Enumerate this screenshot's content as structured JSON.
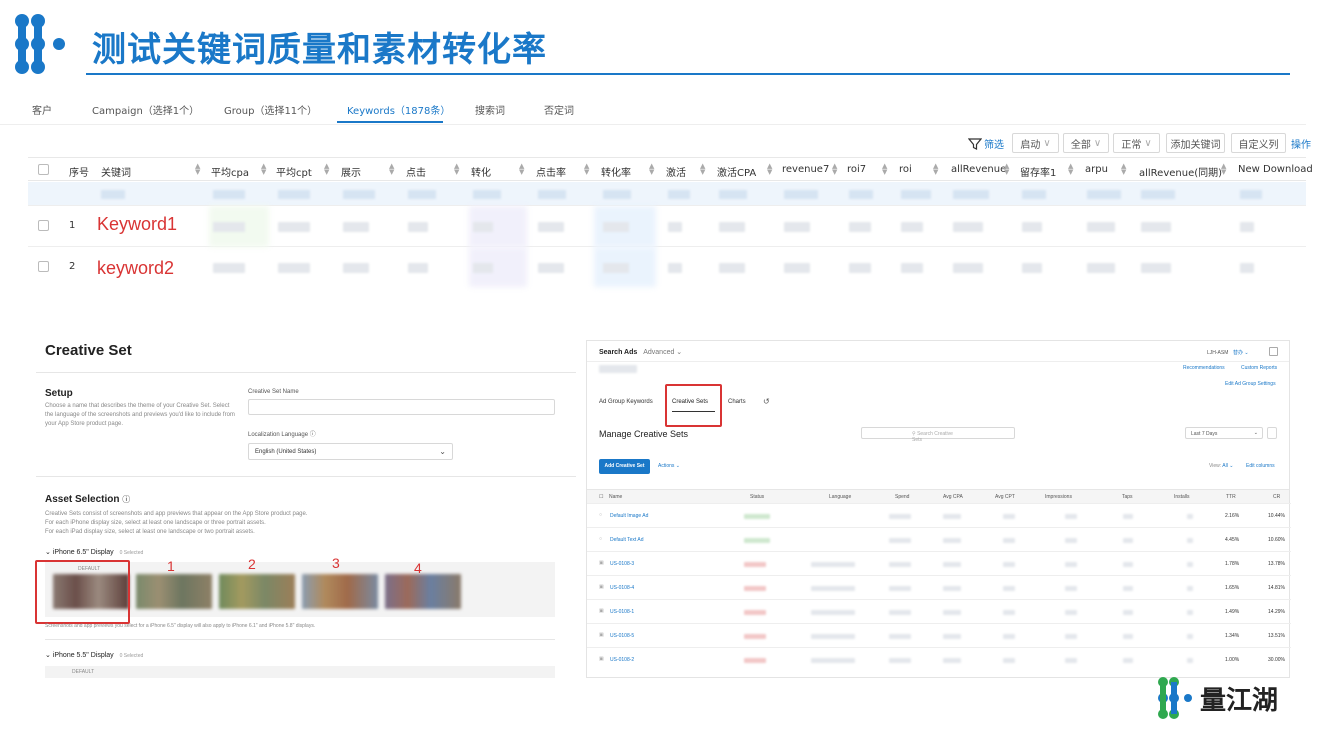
{
  "header": {
    "title": "测试关键词质量和素材转化率"
  },
  "tabs": [
    "客户",
    "Campaign（选择1个）",
    "Group（选择11个）",
    "Keywords（1878条）",
    "搜索词",
    "否定词"
  ],
  "toolbar": {
    "filter": "筛选",
    "status": "启动",
    "scope": "全部",
    "state": "正常",
    "add": "添加关键词",
    "custom": "自定义列",
    "more": "操作"
  },
  "table": {
    "columns": [
      "序号",
      "关键词",
      "平均cpa",
      "平均cpt",
      "展示",
      "点击",
      "转化",
      "点击率",
      "转化率",
      "激活",
      "激活CPA",
      "revenue7",
      "roi7",
      "roi",
      "allRevenue",
      "留存率1",
      "arpu",
      "allRevenue(同期)",
      "New Download"
    ],
    "rows": [
      {
        "index": "1",
        "keyword": "Keyword1"
      },
      {
        "index": "2",
        "keyword": "keyword2"
      }
    ]
  },
  "creative_set": {
    "title": "Creative Set",
    "setup_title": "Setup",
    "setup_desc": "Choose a name that describes the theme of your Creative Set. Select the language of the screenshots and previews you'd like to include from your App Store product page.",
    "name_label": "Creative Set Name",
    "lang_label": "Localization Language",
    "lang_value": "English (United States)",
    "asset_title": "Asset Selection",
    "asset_desc1": "Creative Sets consist of screenshots and app previews that appear on the App Store product page.",
    "asset_desc2": "For each iPhone display size, select at least one landscape or three portrait assets.",
    "asset_desc3": "For each iPad display size, select at least one landscape or two portrait assets.",
    "iphone65": "iPhone 6.5\" Display",
    "iphone65_sel": "0 Selected",
    "default_label": "DEFAULT",
    "numbers": [
      "1",
      "2",
      "3",
      "4"
    ],
    "apply_note": "Screenshots and app previews you select for a iPhone 6.5\" display will also apply to iPhone 6.1\" and iPhone 5.8\" displays.",
    "iphone55": "iPhone 5.5\" Display",
    "iphone55_sel": "0 Selected",
    "default_label2": "DEFAULT"
  },
  "search_ads": {
    "brand": "Search Ads",
    "mode": "Advanced",
    "account": "LJH-ASM",
    "user": "替办",
    "recs": "Recommendations",
    "reports": "Custom Reports",
    "edit_group": "Edit Ad Group Settings",
    "tabs": [
      "Ad Group Keywords",
      "Creative Sets",
      "Charts"
    ],
    "manage": "Manage Creative Sets",
    "search_placeholder": "Search Creative Sets",
    "range": "Last 7 Days",
    "add_btn": "Add Creative Set",
    "actions": "Actions",
    "view": "View:",
    "view_all": "All",
    "edit_cols": "Edit columns",
    "columns": [
      "Name",
      "Status",
      "Language",
      "Spend",
      "Avg CPA",
      "Avg CPT",
      "Impressions",
      "Taps",
      "Installs",
      "TTR",
      "CR"
    ],
    "rows": [
      {
        "name": "Default Image Ad",
        "ttr": "2.16%",
        "cr": "10.44%"
      },
      {
        "name": "Default Text Ad",
        "ttr": "4.45%",
        "cr": "10.60%"
      },
      {
        "name": "US-0108-3",
        "ttr": "1.78%",
        "cr": "13.78%"
      },
      {
        "name": "US-0108-4",
        "ttr": "1.65%",
        "cr": "14.81%"
      },
      {
        "name": "US-0108-1",
        "ttr": "1.49%",
        "cr": "14.29%"
      },
      {
        "name": "US-0108-5",
        "ttr": "1.34%",
        "cr": "13.51%"
      },
      {
        "name": "US-0108-2",
        "ttr": "1.00%",
        "cr": "30.00%"
      }
    ]
  },
  "brand_logo": {
    "text": "量江湖"
  },
  "colors": {
    "accent": "#1a78c8",
    "highlight": "#d93434"
  }
}
